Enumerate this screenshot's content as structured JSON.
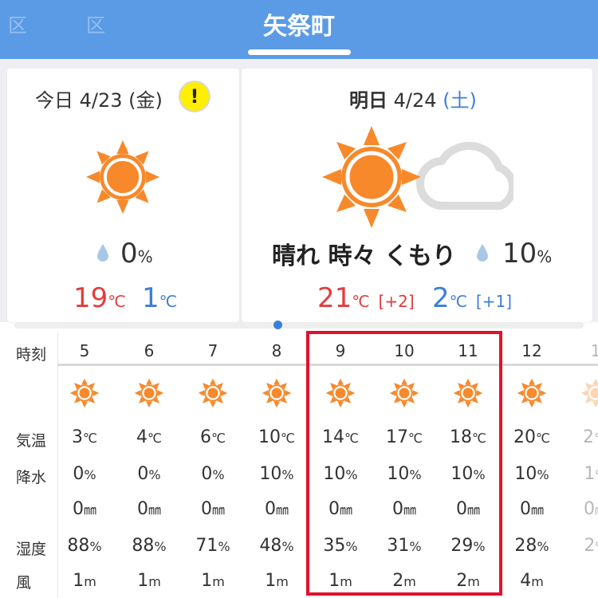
{
  "header": {
    "title": "矢祭町",
    "ghost_tabs": [
      "区",
      "区"
    ]
  },
  "today": {
    "date_label": "今日 4/23 (金)",
    "warning_icon": "!",
    "icon": "sun-icon",
    "precip": "0",
    "precip_unit": "%",
    "high": "19",
    "low": "1",
    "temp_unit": "℃"
  },
  "tomorrow": {
    "day": "明日",
    "date": "4/24",
    "weekday": "(土)",
    "icon": "sun-cloud-icon",
    "weather_text": "晴れ 時々 くもり",
    "precip": "10",
    "precip_unit": "%",
    "high": "21",
    "high_diff": "[+2]",
    "low": "2",
    "low_diff": "[+1]",
    "temp_unit": "℃"
  },
  "hourly": {
    "labels": {
      "time": "時刻",
      "temp": "気温",
      "precip": "降水",
      "humidity": "湿度",
      "wind": "風"
    },
    "hours": [
      "5",
      "6",
      "7",
      "8",
      "9",
      "10",
      "11",
      "12",
      "1"
    ],
    "temps": [
      "3",
      "4",
      "6",
      "10",
      "14",
      "17",
      "18",
      "20",
      "2"
    ],
    "temp_unit": "℃",
    "precip_chance": [
      "0",
      "0",
      "0",
      "10",
      "10",
      "10",
      "10",
      "10",
      "1"
    ],
    "precip_chance_unit": "%",
    "precip_amount": [
      "0",
      "0",
      "0",
      "0",
      "0",
      "0",
      "0",
      "0",
      "0"
    ],
    "precip_amount_unit": "㎜",
    "humidity": [
      "88",
      "88",
      "71",
      "48",
      "35",
      "31",
      "29",
      "28",
      "2"
    ],
    "humidity_unit": "%",
    "wind": [
      "1",
      "1",
      "1",
      "1",
      "1",
      "2",
      "2",
      "4",
      ""
    ],
    "wind_unit": "m"
  },
  "colors": {
    "header": "#5b9be6",
    "high_temp": "#e23d3d",
    "low_temp": "#3c7fd8",
    "sun": "#f7892b",
    "highlight": "#e3102d"
  }
}
